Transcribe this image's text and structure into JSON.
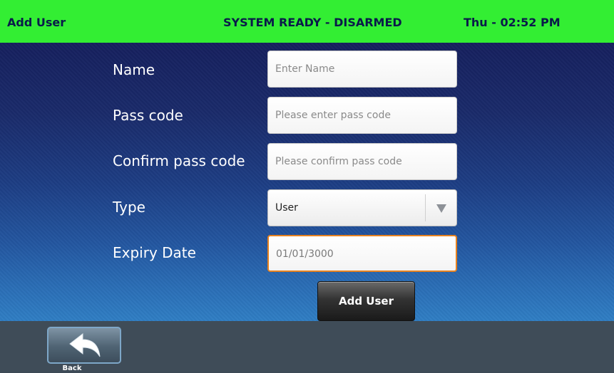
{
  "status_bar": {
    "title": "Add User",
    "status": "SYSTEM READY - DISARMED",
    "clock": "Thu - 02:52 PM",
    "color": "#33ee33"
  },
  "form": {
    "name": {
      "label": "Name",
      "placeholder": "Enter Name",
      "value": ""
    },
    "pass_code": {
      "label": "Pass code",
      "placeholder": "Please enter pass code",
      "value": ""
    },
    "confirm_pass_code": {
      "label": "Confirm pass code",
      "placeholder": "Please confirm pass code",
      "value": ""
    },
    "type": {
      "label": "Type",
      "selected": "User",
      "icon": "dropdown-arrow-icon"
    },
    "expiry_date": {
      "label": "Expiry Date",
      "value": "01/01/3000",
      "focused": true
    },
    "submit_label": "Add User"
  },
  "footer": {
    "back_label": "Back",
    "back_icon": "back-arrow-icon"
  },
  "colors": {
    "accent_focus": "#e8821e",
    "background_top": "#16205e",
    "background_bottom": "#2f7ec4"
  }
}
